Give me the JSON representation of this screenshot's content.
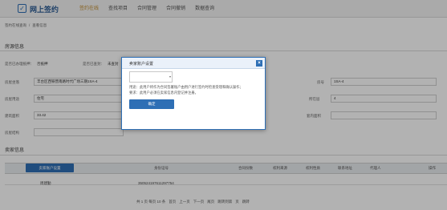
{
  "header": {
    "logo_glyph": "✓",
    "title": "网上签约",
    "nav": [
      {
        "label": "签约在线",
        "active": true
      },
      {
        "label": "查找项目",
        "active": false
      },
      {
        "label": "合同管理",
        "active": false
      },
      {
        "label": "合同撤销",
        "active": false
      },
      {
        "label": "数据查询",
        "active": false
      }
    ]
  },
  "breadcrumb": {
    "parent": "签约在线查询",
    "current": "查看信息"
  },
  "house_section": {
    "title": "房源信息",
    "status_label": "是否已办理抵押：",
    "status_value": "否抵押",
    "seal_label": "是否已查封：",
    "seal_value": "未查封",
    "fields": {
      "address_label": "房屋坐落",
      "address_value": "丰台区西铁营南路时代广场三期1SA-4",
      "room_label": "房号",
      "room_value": "1SA-4",
      "use_label": "房屋用途",
      "use_value": "住宅",
      "floor_label": "所在层",
      "floor_value": "4",
      "area_label": "建筑面积",
      "area_value": "33.42",
      "inner_area_label": "套内面积",
      "inner_area_value": "",
      "structure_label": "房屋结构",
      "structure_value": ""
    }
  },
  "seller_section": {
    "title": "卖家信息",
    "set_button": "卖家账户设置",
    "columns": [
      "身份证号",
      "合同份数",
      "权利来源",
      "权利性质",
      "联系地址",
      "代理人",
      "操作"
    ],
    "rows": [
      {
        "name": "周建勤",
        "id": "350524197611297754"
      }
    ]
  },
  "pager": {
    "text_first": "共 1 页 每页 10 条",
    "first": "首页",
    "prev": "上一页",
    "next": "下一页",
    "last": "尾页",
    "jump": "跳转到第",
    "page": "页",
    "go": "跳转"
  },
  "modal": {
    "title": "卖家账户设置",
    "close_glyph": "×",
    "note_line1": "用途：此用户将作为合同签署账户由用户进行签约时检查受理和确认操作；",
    "note_line2": "要求：此用户必须在卖家信息内登记并注册。",
    "ok_button": "确定"
  },
  "colors": {
    "accent": "#2e6fb5",
    "nav_active": "#c08a2a"
  }
}
